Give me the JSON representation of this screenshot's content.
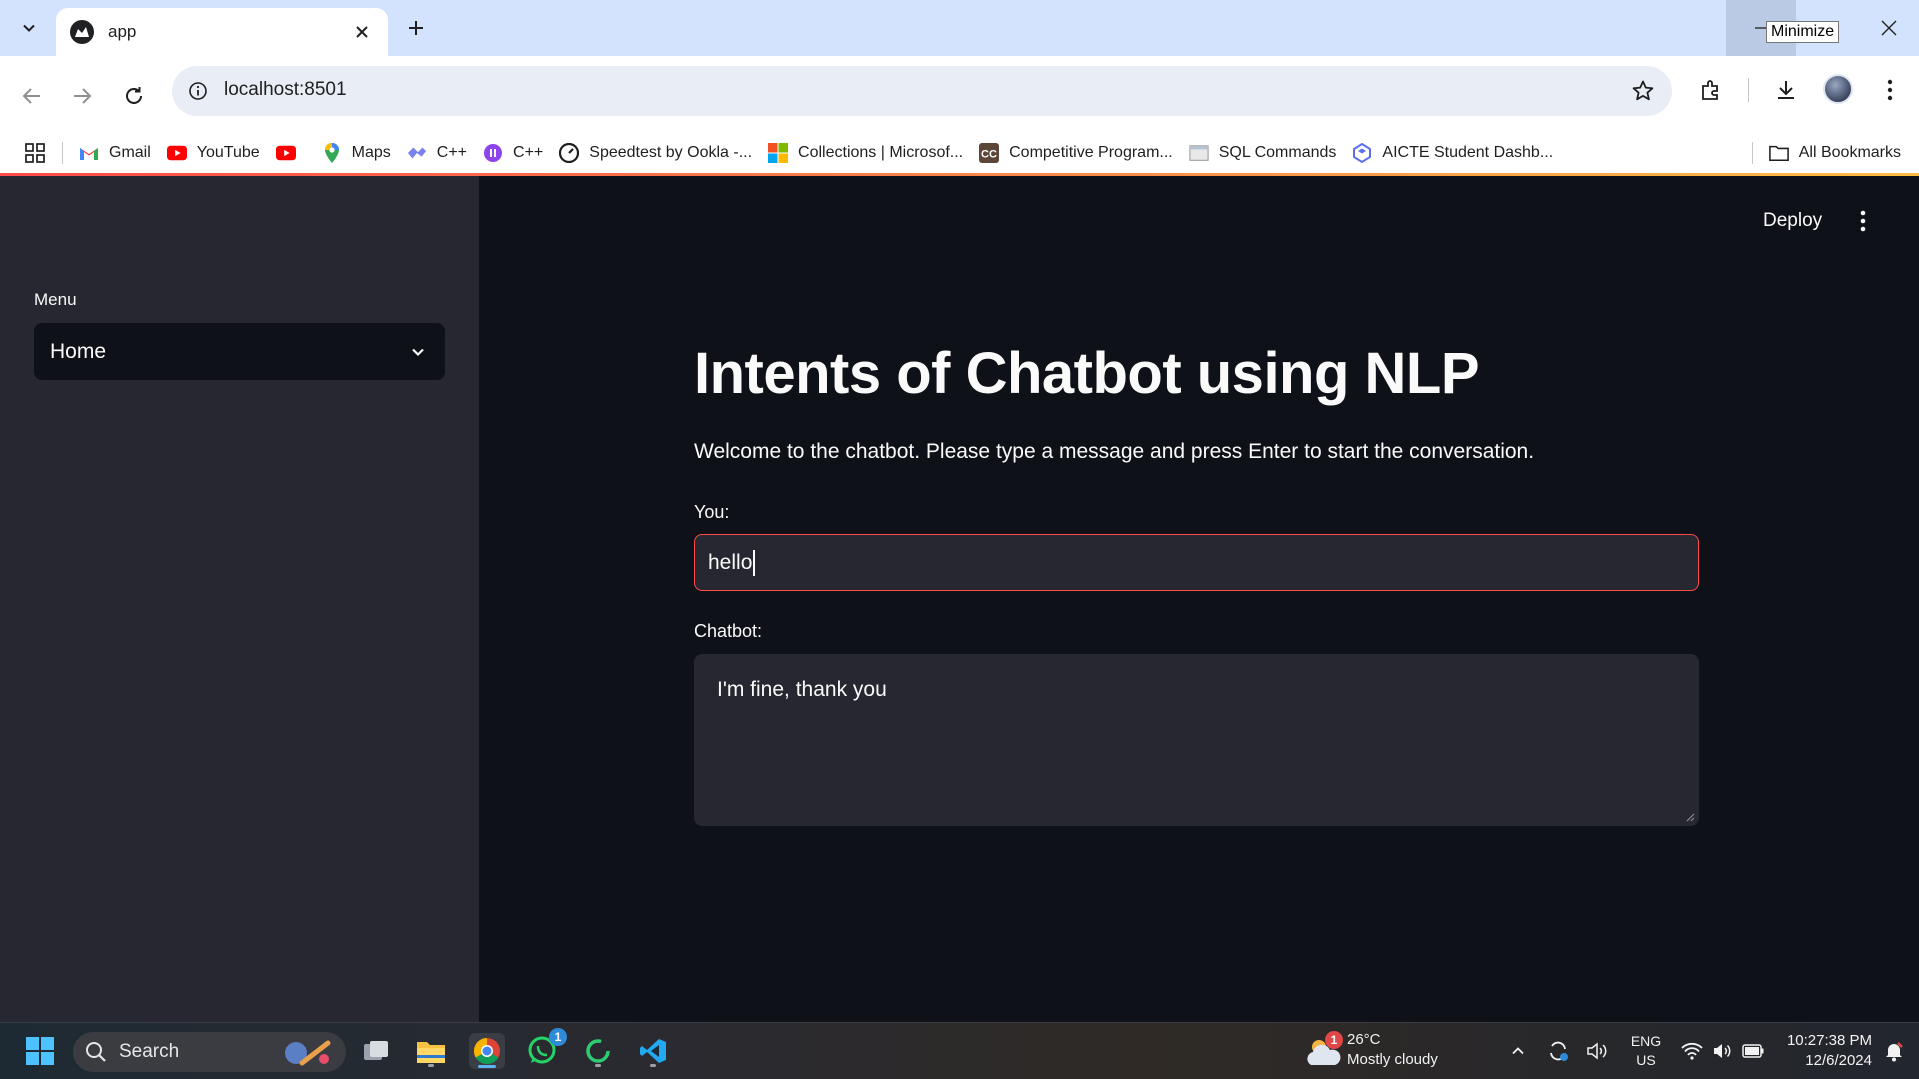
{
  "browser": {
    "tab_title": "app",
    "url": "localhost:8501",
    "tooltip": "Minimize",
    "bookmarks": [
      {
        "label": "Gmail",
        "icon": "gmail-icon"
      },
      {
        "label": "YouTube",
        "icon": "youtube-icon"
      },
      {
        "label": "",
        "icon": "youtube-icon"
      },
      {
        "label": "Maps",
        "icon": "maps-icon"
      },
      {
        "label": "C++",
        "icon": "cpp-icon"
      },
      {
        "label": "C++",
        "icon": "cpp-icon"
      },
      {
        "label": "Speedtest by Ookla -...",
        "icon": "speedtest-icon"
      },
      {
        "label": "Collections | Microsof...",
        "icon": "microsoft-icon"
      },
      {
        "label": "Competitive Program...",
        "icon": "codechef-icon"
      },
      {
        "label": "SQL Commands",
        "icon": "page-icon"
      },
      {
        "label": "AICTE Student Dashb...",
        "icon": "aicte-icon"
      }
    ],
    "all_bookmarks": "All Bookmarks"
  },
  "app": {
    "sidebar": {
      "menu_label": "Menu",
      "selected": "Home"
    },
    "header": {
      "deploy_label": "Deploy"
    },
    "title": "Intents of Chatbot using NLP",
    "intro": "Welcome to the chatbot. Please type a message and press Enter to start the conversation.",
    "you_label": "You:",
    "you_value": "hello",
    "chatbot_label": "Chatbot:",
    "chatbot_value": "I'm fine, thank you"
  },
  "taskbar": {
    "search_label": "Search",
    "weather_temp": "26°C",
    "weather_desc": "Mostly cloudy",
    "weather_badge": "1",
    "whatsapp_badge": "1",
    "lang_top": "ENG",
    "lang_bottom": "US",
    "time": "10:27:38 PM",
    "date": "12/6/2024"
  },
  "colors": {
    "accent": "#ff4b4b",
    "sidebar_bg": "#262730",
    "main_bg": "#0e1117",
    "tabstrip_bg": "#d3e3fd"
  }
}
